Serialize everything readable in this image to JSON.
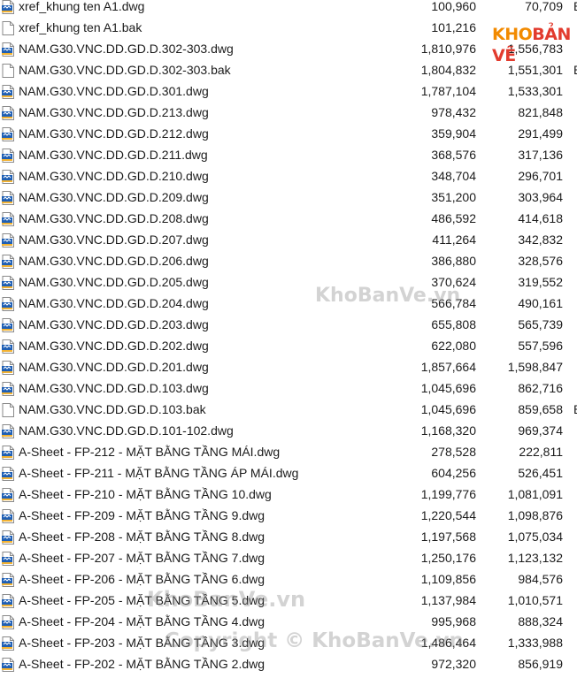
{
  "files": [
    {
      "name": "xref_khung ten A1.dwg",
      "type": "dwg",
      "size": "100,960",
      "packed": "70,709",
      "cut": "B"
    },
    {
      "name": "xref_khung ten A1.bak",
      "type": "bak",
      "size": "101,216",
      "packed": "",
      "cut": ""
    },
    {
      "name": "NAM.G30.VNC.DD.GD.D.302-303.dwg",
      "type": "dwg",
      "size": "1,810,976",
      "packed": "1,556,783",
      "cut": ""
    },
    {
      "name": "NAM.G30.VNC.DD.GD.D.302-303.bak",
      "type": "bak",
      "size": "1,804,832",
      "packed": "1,551,301",
      "cut": "B"
    },
    {
      "name": "NAM.G30.VNC.DD.GD.D.301.dwg",
      "type": "dwg",
      "size": "1,787,104",
      "packed": "1,533,301",
      "cut": ""
    },
    {
      "name": "NAM.G30.VNC.DD.GD.D.213.dwg",
      "type": "dwg",
      "size": "978,432",
      "packed": "821,848",
      "cut": ""
    },
    {
      "name": "NAM.G30.VNC.DD.GD.D.212.dwg",
      "type": "dwg",
      "size": "359,904",
      "packed": "291,499",
      "cut": ""
    },
    {
      "name": "NAM.G30.VNC.DD.GD.D.211.dwg",
      "type": "dwg",
      "size": "368,576",
      "packed": "317,136",
      "cut": ""
    },
    {
      "name": "NAM.G30.VNC.DD.GD.D.210.dwg",
      "type": "dwg",
      "size": "348,704",
      "packed": "296,701",
      "cut": ""
    },
    {
      "name": "NAM.G30.VNC.DD.GD.D.209.dwg",
      "type": "dwg",
      "size": "351,200",
      "packed": "303,964",
      "cut": ""
    },
    {
      "name": "NAM.G30.VNC.DD.GD.D.208.dwg",
      "type": "dwg",
      "size": "486,592",
      "packed": "414,618",
      "cut": ""
    },
    {
      "name": "NAM.G30.VNC.DD.GD.D.207.dwg",
      "type": "dwg",
      "size": "411,264",
      "packed": "342,832",
      "cut": ""
    },
    {
      "name": "NAM.G30.VNC.DD.GD.D.206.dwg",
      "type": "dwg",
      "size": "386,880",
      "packed": "328,576",
      "cut": ""
    },
    {
      "name": "NAM.G30.VNC.DD.GD.D.205.dwg",
      "type": "dwg",
      "size": "370,624",
      "packed": "319,552",
      "cut": ""
    },
    {
      "name": "NAM.G30.VNC.DD.GD.D.204.dwg",
      "type": "dwg",
      "size": "566,784",
      "packed": "490,161",
      "cut": ""
    },
    {
      "name": "NAM.G30.VNC.DD.GD.D.203.dwg",
      "type": "dwg",
      "size": "655,808",
      "packed": "565,739",
      "cut": ""
    },
    {
      "name": "NAM.G30.VNC.DD.GD.D.202.dwg",
      "type": "dwg",
      "size": "622,080",
      "packed": "557,596",
      "cut": ""
    },
    {
      "name": "NAM.G30.VNC.DD.GD.D.201.dwg",
      "type": "dwg",
      "size": "1,857,664",
      "packed": "1,598,847",
      "cut": ""
    },
    {
      "name": "NAM.G30.VNC.DD.GD.D.103.dwg",
      "type": "dwg",
      "size": "1,045,696",
      "packed": "862,716",
      "cut": ""
    },
    {
      "name": "NAM.G30.VNC.DD.GD.D.103.bak",
      "type": "bak",
      "size": "1,045,696",
      "packed": "859,658",
      "cut": "B"
    },
    {
      "name": "NAM.G30.VNC.DD.GD.D.101-102.dwg",
      "type": "dwg",
      "size": "1,168,320",
      "packed": "969,374",
      "cut": ""
    },
    {
      "name": "A-Sheet - FP-212 - MẶT BẰNG TẦNG MÁI.dwg",
      "type": "dwg",
      "size": "278,528",
      "packed": "222,811",
      "cut": ""
    },
    {
      "name": "A-Sheet - FP-211 - MẶT BẰNG TẦNG ÁP MÁI.dwg",
      "type": "dwg",
      "size": "604,256",
      "packed": "526,451",
      "cut": ""
    },
    {
      "name": "A-Sheet - FP-210 - MẶT BẰNG TẦNG 10.dwg",
      "type": "dwg",
      "size": "1,199,776",
      "packed": "1,081,091",
      "cut": ""
    },
    {
      "name": "A-Sheet - FP-209 - MẶT BẰNG TẦNG 9.dwg",
      "type": "dwg",
      "size": "1,220,544",
      "packed": "1,098,876",
      "cut": ""
    },
    {
      "name": "A-Sheet - FP-208 - MẶT BẰNG TẦNG 8.dwg",
      "type": "dwg",
      "size": "1,197,568",
      "packed": "1,075,034",
      "cut": ""
    },
    {
      "name": "A-Sheet - FP-207 - MẶT BẰNG TẦNG 7.dwg",
      "type": "dwg",
      "size": "1,250,176",
      "packed": "1,123,132",
      "cut": ""
    },
    {
      "name": "A-Sheet - FP-206 - MẶT BẰNG TẦNG 6.dwg",
      "type": "dwg",
      "size": "1,109,856",
      "packed": "984,576",
      "cut": ""
    },
    {
      "name": "A-Sheet - FP-205 - MẶT BẰNG TẦNG 5.dwg",
      "type": "dwg",
      "size": "1,137,984",
      "packed": "1,010,571",
      "cut": ""
    },
    {
      "name": "A-Sheet - FP-204 - MẶT BẰNG TẦNG 4.dwg",
      "type": "dwg",
      "size": "995,968",
      "packed": "888,324",
      "cut": ""
    },
    {
      "name": "A-Sheet - FP-203 - MẶT BẰNG TẦNG 3.dwg",
      "type": "dwg",
      "size": "1,486,464",
      "packed": "1,333,988",
      "cut": ""
    },
    {
      "name": "A-Sheet - FP-202 - MẶT BẰNG TẦNG 2.dwg",
      "type": "dwg",
      "size": "972,320",
      "packed": "856,919",
      "cut": ""
    }
  ],
  "logo": {
    "part1": "KHO",
    "part2": "BẢN VẼ",
    "color1": "#f28a00",
    "color2": "#e23b2e"
  },
  "watermarks": {
    "mid": "KhoBanVe.vn",
    "lower": "KhoBanVe.vn",
    "copyright": "Copyright © KhoBanVe.vn"
  },
  "icons": {
    "dwg": "dwg-file-icon",
    "bak": "blank-file-icon"
  },
  "colors": {
    "dwg_badge": "#1f5fb4",
    "dwg_strip": "#f2b233",
    "file_outline": "#8a8a8a"
  }
}
